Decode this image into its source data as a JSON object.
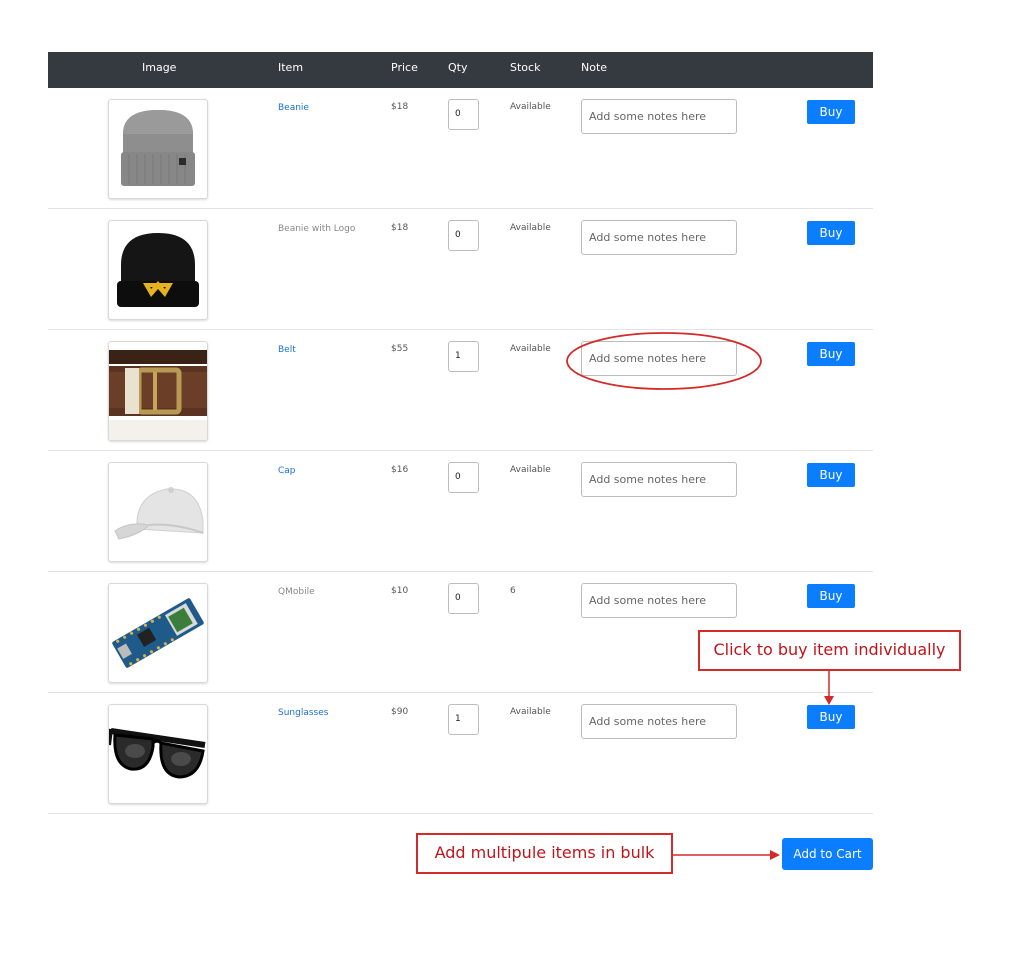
{
  "table": {
    "headers": {
      "image": "Image",
      "item": "Item",
      "price": "Price",
      "qty": "Qty",
      "stock": "Stock",
      "note": "Note"
    },
    "rows": [
      {
        "image_icon": "gray-beanie-image",
        "item": "Beanie",
        "item_style": "link",
        "price": "$18",
        "qty": "0",
        "stock": "Available",
        "note_placeholder": "Add some notes here",
        "buy_label": "Buy"
      },
      {
        "image_icon": "black-beanie-logo-image",
        "item": "Beanie with Logo",
        "item_style": "plain",
        "price": "$18",
        "qty": "0",
        "stock": "Available",
        "note_placeholder": "Add some notes here",
        "buy_label": "Buy"
      },
      {
        "image_icon": "leather-belt-image",
        "item": "Belt",
        "item_style": "link",
        "price": "$55",
        "qty": "1",
        "stock": "Available",
        "note_placeholder": "Add some notes here",
        "buy_label": "Buy"
      },
      {
        "image_icon": "white-cap-image",
        "item": "Cap",
        "item_style": "link",
        "price": "$16",
        "qty": "0",
        "stock": "Available",
        "note_placeholder": "Add some notes here",
        "buy_label": "Buy"
      },
      {
        "image_icon": "circuit-board-image",
        "item": "QMobile",
        "item_style": "plain",
        "price": "$10",
        "qty": "0",
        "stock": "6",
        "note_placeholder": "Add some notes here",
        "buy_label": "Buy"
      },
      {
        "image_icon": "sunglasses-image",
        "item": "Sunglasses",
        "item_style": "link",
        "price": "$90",
        "qty": "1",
        "stock": "Available",
        "note_placeholder": "Add some notes here",
        "buy_label": "Buy"
      }
    ]
  },
  "cart": {
    "add_to_cart_label": "Add to Cart"
  },
  "annotations": {
    "buy_callout": "Click to buy item individually",
    "bulk_callout": "Add multipule items in bulk"
  },
  "colors": {
    "header_bg": "#343a40",
    "primary_button": "#0b7dff",
    "link": "#1a6fd6",
    "annotation": "#d42a2a"
  }
}
